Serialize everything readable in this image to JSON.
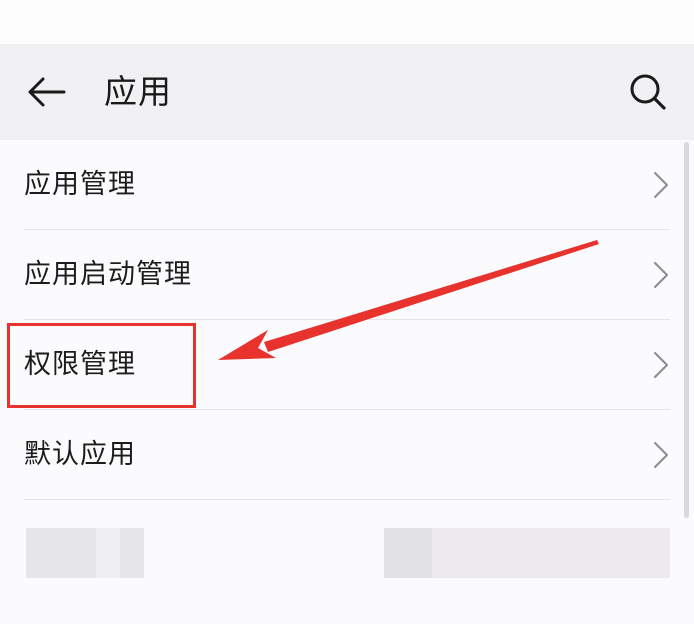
{
  "app_bar": {
    "title": "应用",
    "back_icon": "arrow-left-icon",
    "search_icon": "search-icon"
  },
  "list": {
    "items": [
      {
        "label": "应用管理",
        "icon": "chevron-right-icon"
      },
      {
        "label": "应用启动管理",
        "icon": "chevron-right-icon"
      },
      {
        "label": "权限管理",
        "icon": "chevron-right-icon"
      },
      {
        "label": "默认应用",
        "icon": "chevron-right-icon"
      }
    ]
  },
  "annotation": {
    "color": "#e8322d",
    "highlighted_item": "权限管理"
  }
}
